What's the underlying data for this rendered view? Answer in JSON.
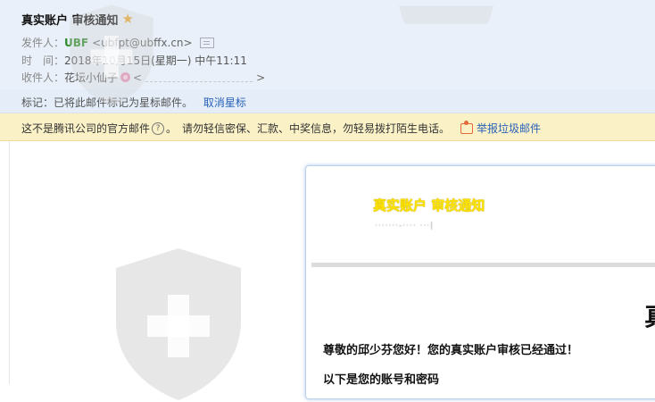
{
  "header": {
    "subject": "真实账户 审核通知",
    "sender": {
      "label": "发件人：",
      "name": "UBF",
      "address": "<ubfpt@ubffx.cn>"
    },
    "time": {
      "label": "时　间：",
      "value": "2018年10月15日(星期一) 中午11:11"
    },
    "recipient": {
      "label": "收件人：",
      "name": "花坛小仙子",
      "addr_open": "<",
      "addr_close": ">"
    }
  },
  "mark_bar": {
    "text": "标记：已将此邮件标记为星标邮件。",
    "link": "取消星标"
  },
  "warning_bar": {
    "text_a": "这不是腾讯公司的官方邮件",
    "text_b": "。　请勿轻信密保、汇款、中奖信息，勿轻易拨打陌生电话。",
    "report": "举报垃圾邮件"
  },
  "email_body": {
    "title": "真实账户 审核通知",
    "subline": "·······-···· ···|",
    "big_char": "真",
    "greeting": "尊敬的邱少芬您好！您的真实账户审核已经通过！",
    "account_line": "以下是您的账号和密码"
  },
  "colors": {
    "header_bg": "#e9f0f9",
    "warn_bg": "#fbf1c7",
    "link": "#2a62b8",
    "sender": "#2c8a2a",
    "title": "#ffe400"
  },
  "icons": {
    "star": "star-icon",
    "vcard": "contact-card-icon",
    "flower": "flower-icon",
    "help": "help-icon",
    "report": "report-spam-icon",
    "watermark": "shield-cross-icon"
  }
}
